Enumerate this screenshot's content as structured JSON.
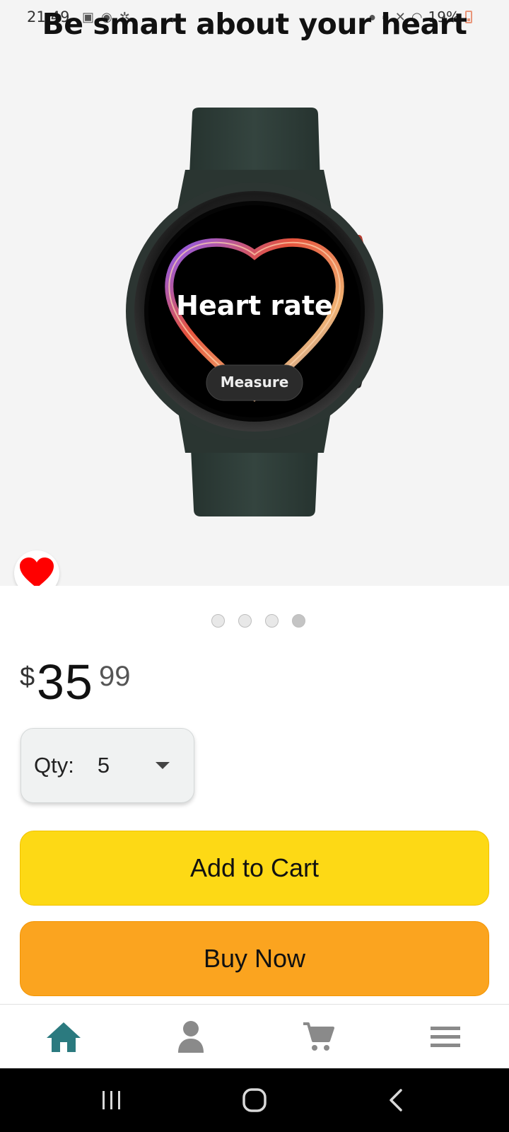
{
  "status_bar": {
    "time": "21:49",
    "battery": "19%"
  },
  "hero": {
    "title": "Be smart about your heart",
    "watch_screen_title": "Heart rate",
    "watch_screen_button": "Measure"
  },
  "carousel": {
    "page_count": 4,
    "active_index": 3
  },
  "price": {
    "currency": "$",
    "whole": "35",
    "cents": "99"
  },
  "quantity": {
    "label": "Qty:",
    "value": "5"
  },
  "buttons": {
    "add_to_cart": "Add to Cart",
    "buy_now": "Buy Now"
  },
  "bottom_nav": {
    "items": [
      {
        "icon": "home-icon",
        "active": true
      },
      {
        "icon": "account-icon",
        "active": false
      },
      {
        "icon": "cart-icon",
        "active": false
      },
      {
        "icon": "menu-icon",
        "active": false
      }
    ]
  },
  "colors": {
    "add_to_cart": "#fdd915",
    "buy_now": "#fba41f",
    "nav_active": "#2b7a7f",
    "nav_inactive": "#8a8a8a",
    "favorite": "#ff0000"
  }
}
